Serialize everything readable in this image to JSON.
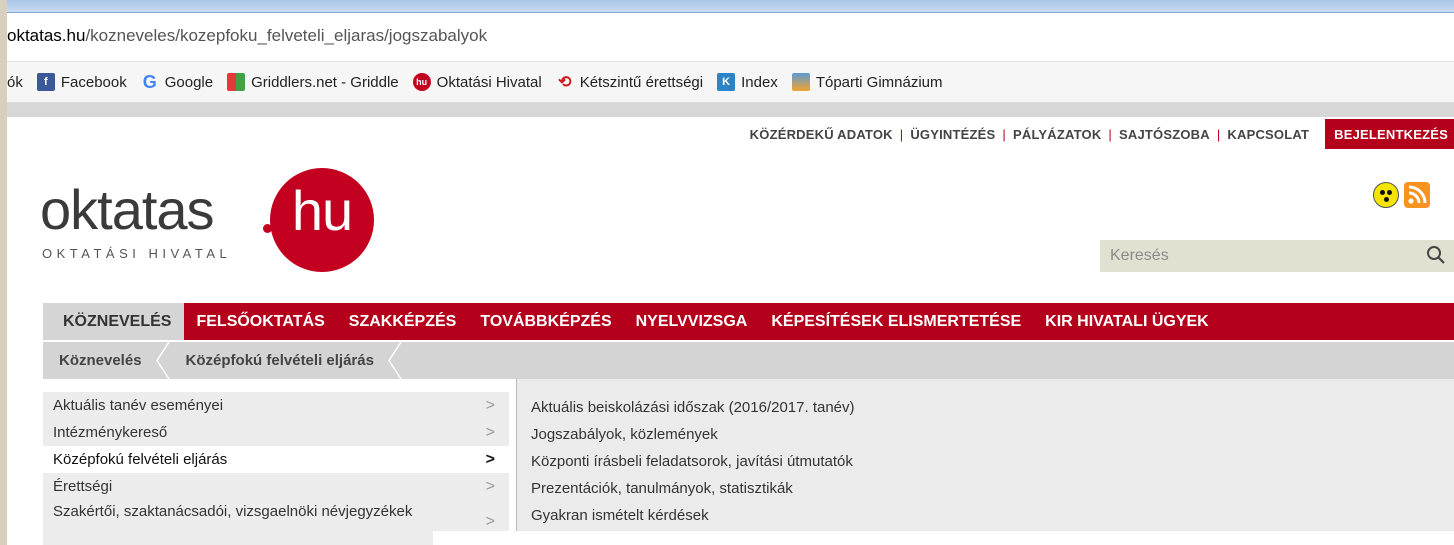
{
  "browser": {
    "url_host": "oktatas.hu",
    "url_path": "/kozneveles/kozepfoku_felveteli_eljaras/jogszabalyok",
    "bookmarks_first": "ók",
    "bookmarks": [
      {
        "label": "Facebook",
        "icon": "facebook-icon"
      },
      {
        "label": "Google",
        "icon": "google-icon"
      },
      {
        "label": "Griddlers.net - Griddle",
        "icon": "griddlers-icon"
      },
      {
        "label": "Oktatási Hivatal",
        "icon": "oktatasi-hivatal-icon"
      },
      {
        "label": "Kétszintű érettségi",
        "icon": "ketszintu-icon"
      },
      {
        "label": "Index",
        "icon": "index-icon"
      },
      {
        "label": "Tóparti Gimnázium",
        "icon": "toparti-icon"
      }
    ]
  },
  "topnav": {
    "items": [
      "KÖZÉRDEKŰ ADATOK",
      "ÜGYINTÉZÉS",
      "PÁLYÁZATOK",
      "SAJTÓSZOBA",
      "KAPCSOLAT"
    ],
    "login": "BEJELENTKEZÉS"
  },
  "logo": {
    "main": "oktatas",
    "circle": "hu",
    "sub": "OKTATÁSI HIVATAL"
  },
  "search": {
    "placeholder": "Keresés"
  },
  "mainnav": {
    "items": [
      "KÖZNEVELÉS",
      "FELSŐOKTATÁS",
      "SZAKKÉPZÉS",
      "TOVÁBBKÉPZÉS",
      "NYELVVIZSGA",
      "KÉPESÍTÉSEK ELISMERTETÉSE",
      "KIR HIVATALI ÜGYEK"
    ]
  },
  "breadcrumb": {
    "items": [
      "Köznevelés",
      "Középfokú felvételi eljárás"
    ]
  },
  "leftmenu": {
    "items": [
      "Aktuális tanév eseményei",
      "Intézménykereső",
      "Középfokú felvételi eljárás",
      "Érettségi",
      "Szakértői, szaktanácsadói, vizsgaelnöki névjegyzékek"
    ],
    "chevron": ">"
  },
  "submenu": {
    "items": [
      "Aktuális beiskolázási időszak (2016/2017. tanév)",
      "Jogszabályok, közlemények",
      "Központi írásbeli feladatsorok, javítási útmutatók",
      "Prezentációk, tanulmányok, statisztikák",
      "Gyakran ismételt kérdések"
    ]
  },
  "colors": {
    "brand_red": "#b5001b",
    "nav_gray": "#d4d4d4"
  }
}
